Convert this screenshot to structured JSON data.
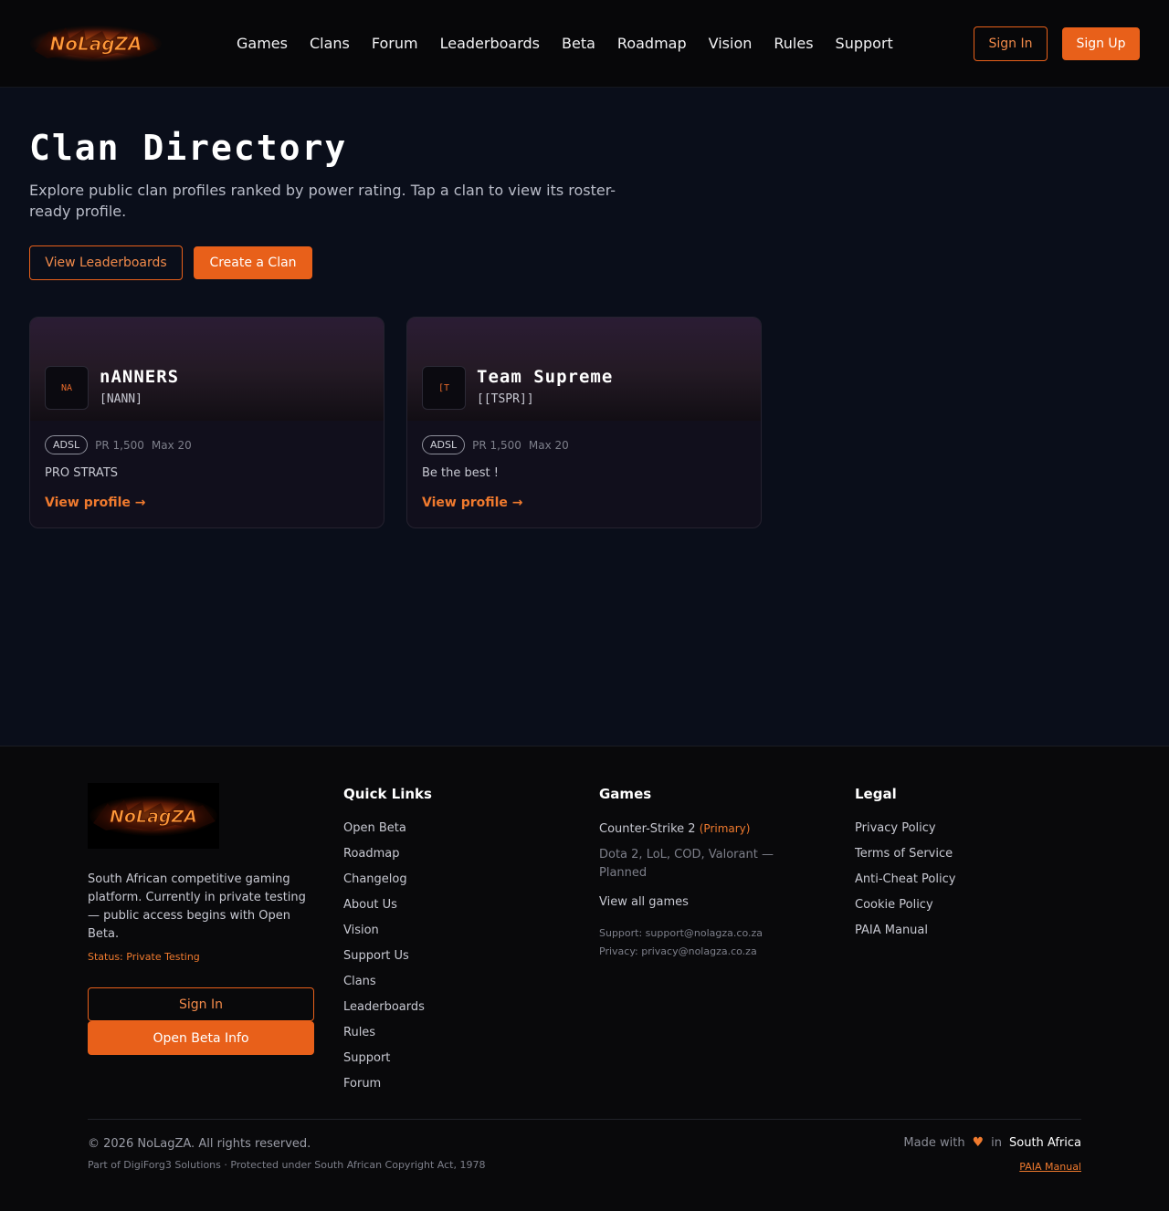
{
  "header": {
    "logo_text": "NoLagZA",
    "nav": [
      "Games",
      "Clans",
      "Forum",
      "Leaderboards",
      "Beta",
      "Roadmap",
      "Vision",
      "Rules",
      "Support"
    ],
    "sign_in": "Sign In",
    "sign_up": "Sign Up"
  },
  "main": {
    "title": "Clan Directory",
    "subtitle": "Explore public clan profiles ranked by power rating. Tap a clan to view its roster-ready profile.",
    "view_leaderboards": "View Leaderboards",
    "create_clan": "Create a Clan"
  },
  "clans": [
    {
      "avatar": "NA",
      "name": "nANNERS",
      "tag": "[NANN]",
      "badge": "ADSL",
      "pr": "PR 1,500",
      "max": "Max 20",
      "description": "PRO STRATS",
      "link": "View profile →"
    },
    {
      "avatar": "[T",
      "name": "Team Supreme",
      "tag": "[[TSPR]]",
      "badge": "ADSL",
      "pr": "PR 1,500",
      "max": "Max 20",
      "description": "Be the best !",
      "link": "View profile →"
    }
  ],
  "footer": {
    "logo_text": "NoLagZA",
    "about": "South African competitive gaming platform. Currently in private testing — public access begins with Open Beta.",
    "status": "Status: Private Testing",
    "sign_in": "Sign In",
    "open_beta": "Open Beta Info",
    "quick_links": {
      "title": "Quick Links",
      "items": [
        "Open Beta",
        "Roadmap",
        "Changelog",
        "About Us",
        "Vision",
        "Support Us",
        "Clans",
        "Leaderboards",
        "Rules",
        "Support",
        "Forum"
      ]
    },
    "games": {
      "title": "Games",
      "primary_game": "Counter-Strike 2",
      "primary_label": "(Primary)",
      "planned": "Dota 2, LoL, COD, Valorant — Planned",
      "view_all": "View all games",
      "support_email": "Support: support@nolagza.co.za",
      "privacy_email": "Privacy: privacy@nolagza.co.za"
    },
    "legal": {
      "title": "Legal",
      "items": [
        "Privacy Policy",
        "Terms of Service",
        "Anti-Cheat Policy",
        "Cookie Policy",
        "PAIA Manual"
      ]
    },
    "copyright": "© 2026 NoLagZA. All rights reserved.",
    "part_of": "Part of DigiForg3 Solutions · Protected under South African Copyright Act, 1978",
    "made_with": "Made with",
    "in": "in",
    "country": "South Africa",
    "paia": "PAIA Manual"
  },
  "colors": {
    "accent": "#e8601a",
    "background": "#0a0e1a",
    "header_bg": "#070709",
    "card_bg": "#110f1c"
  }
}
